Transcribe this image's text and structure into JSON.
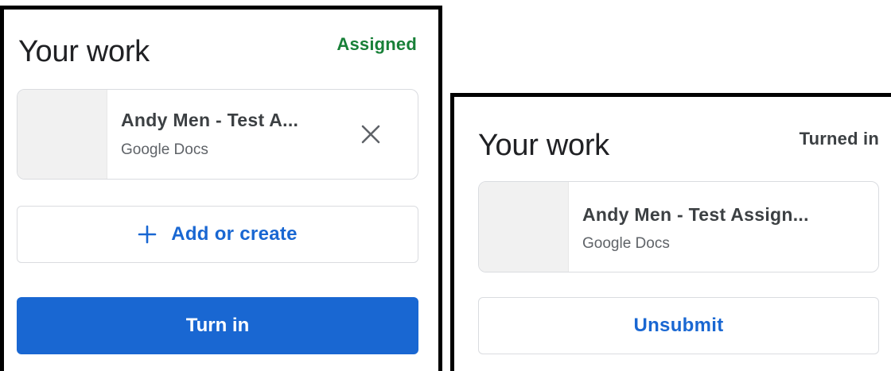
{
  "left_panel": {
    "title": "Your work",
    "status": "Assigned",
    "status_color": "#188038",
    "attachment": {
      "name": "Andy Men - Test A...",
      "type": "Google Docs",
      "remove_icon": "close-icon"
    },
    "add_button": {
      "icon": "plus-icon",
      "label": "Add or create"
    },
    "primary_button": {
      "label": "Turn in"
    }
  },
  "right_panel": {
    "title": "Your work",
    "status": "Turned in",
    "status_color": "#3c4043",
    "attachment": {
      "name": "Andy Men - Test Assign...",
      "type": "Google Docs"
    },
    "unsubmit_button": {
      "label": "Unsubmit"
    }
  },
  "colors": {
    "accent_blue": "#1967d2",
    "border": "#dadce0",
    "thumbnail": "#f1f1f1"
  }
}
